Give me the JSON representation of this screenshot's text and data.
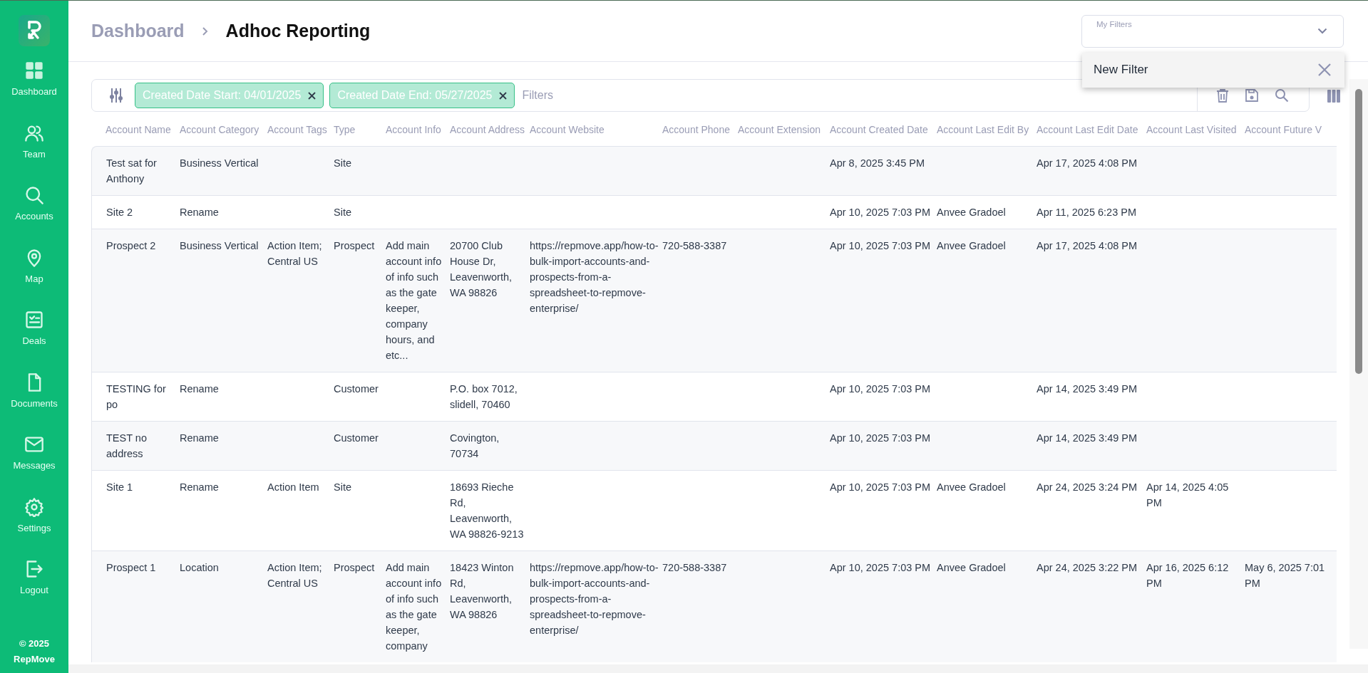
{
  "sidebar": {
    "items": [
      {
        "label": "Dashboard",
        "selected": false
      },
      {
        "label": "Team",
        "selected": false
      },
      {
        "label": "Accounts",
        "selected": false
      },
      {
        "label": "Map",
        "selected": false
      },
      {
        "label": "Deals",
        "selected": false
      },
      {
        "label": "Documents",
        "selected": false
      },
      {
        "label": "Messages",
        "selected": false
      },
      {
        "label": "Settings",
        "selected": false
      },
      {
        "label": "Logout",
        "selected": false
      }
    ],
    "footer": [
      "© 2025",
      "RepMove"
    ]
  },
  "breadcrumb": [
    "Dashboard",
    "Adhoc Reporting"
  ],
  "my_filters": {
    "label": "My Filters",
    "expanded": true,
    "options": [
      "New Filter"
    ]
  },
  "filter_bar": {
    "chips": [
      "Created Date Start: 04/01/2025",
      "Created Date End: 05/27/2025"
    ],
    "placeholder": "Filters"
  },
  "table": {
    "columns": [
      "Account Name",
      "Account Category",
      "Account Tags",
      "Type",
      "Account Info",
      "Account Address",
      "Account Website",
      "Account Phone",
      "Account Extension",
      "Account Created Date",
      "Account Last Edit By",
      "Account Last Edit Date",
      "Account Last Visited",
      "Account Future V"
    ],
    "rows": [
      [
        "Test sat for Anthony",
        "Business Vertical",
        null,
        "Site",
        null,
        null,
        null,
        null,
        null,
        "Apr 8, 2025 3:45 PM",
        null,
        "Apr 17, 2025 4:08 PM",
        null,
        null
      ],
      [
        "Site 2",
        "Rename",
        null,
        "Site",
        null,
        null,
        null,
        null,
        null,
        "Apr 10, 2025 7:03 PM",
        "Anvee Gradoel",
        "Apr 11, 2025 6:23 PM",
        null,
        null
      ],
      [
        "Prospect 2",
        "Business Vertical",
        "Action Item; Central US",
        "Prospect",
        "Add main account info of info such as the gate keeper, company hours, and etc...",
        "20700 Club House Dr, Leavenworth, WA 98826",
        "https://repmove.app/how-to-bulk-import-accounts-and-prospects-from-a-spreadsheet-to-repmove-enterprise/",
        "720-588-3387",
        null,
        "Apr 10, 2025 7:03 PM",
        "Anvee Gradoel",
        "Apr 17, 2025 4:08 PM",
        null,
        null
      ],
      [
        "TESTING for po",
        "Rename",
        null,
        "Customer",
        null,
        "P.O. box 7012, slidell, 70460",
        null,
        null,
        null,
        "Apr 10, 2025 7:03 PM",
        null,
        "Apr 14, 2025 3:49 PM",
        null,
        null
      ],
      [
        "TEST no address",
        "Rename",
        null,
        "Customer",
        null,
        "Covington, 70734",
        null,
        null,
        null,
        "Apr 10, 2025 7:03 PM",
        null,
        "Apr 14, 2025 3:49 PM",
        null,
        null
      ],
      [
        "Site 1",
        "Rename",
        "Action Item",
        "Site",
        null,
        "18693 Rieche Rd, Leavenworth, WA 98826-9213",
        null,
        null,
        null,
        "Apr 10, 2025 7:03 PM",
        "Anvee Gradoel",
        "Apr 24, 2025 3:24 PM",
        "Apr 14, 2025 4:05 PM",
        null
      ],
      [
        "Prospect 1",
        "Location",
        "Action Item; Central US",
        "Prospect",
        "Add main account info of info such as the gate keeper, company",
        "18423 Winton Rd, Leavenworth, WA 98826",
        "https://repmove.app/how-to-bulk-import-accounts-and-prospects-from-a-spreadsheet-to-repmove-enterprise/",
        "720-588-3387",
        null,
        "Apr 10, 2025 7:03 PM",
        "Anvee Gradoel",
        "Apr 24, 2025 3:22 PM",
        "Apr 16, 2025 6:12 PM",
        "May 6, 2025 7:01 PM"
      ]
    ]
  }
}
